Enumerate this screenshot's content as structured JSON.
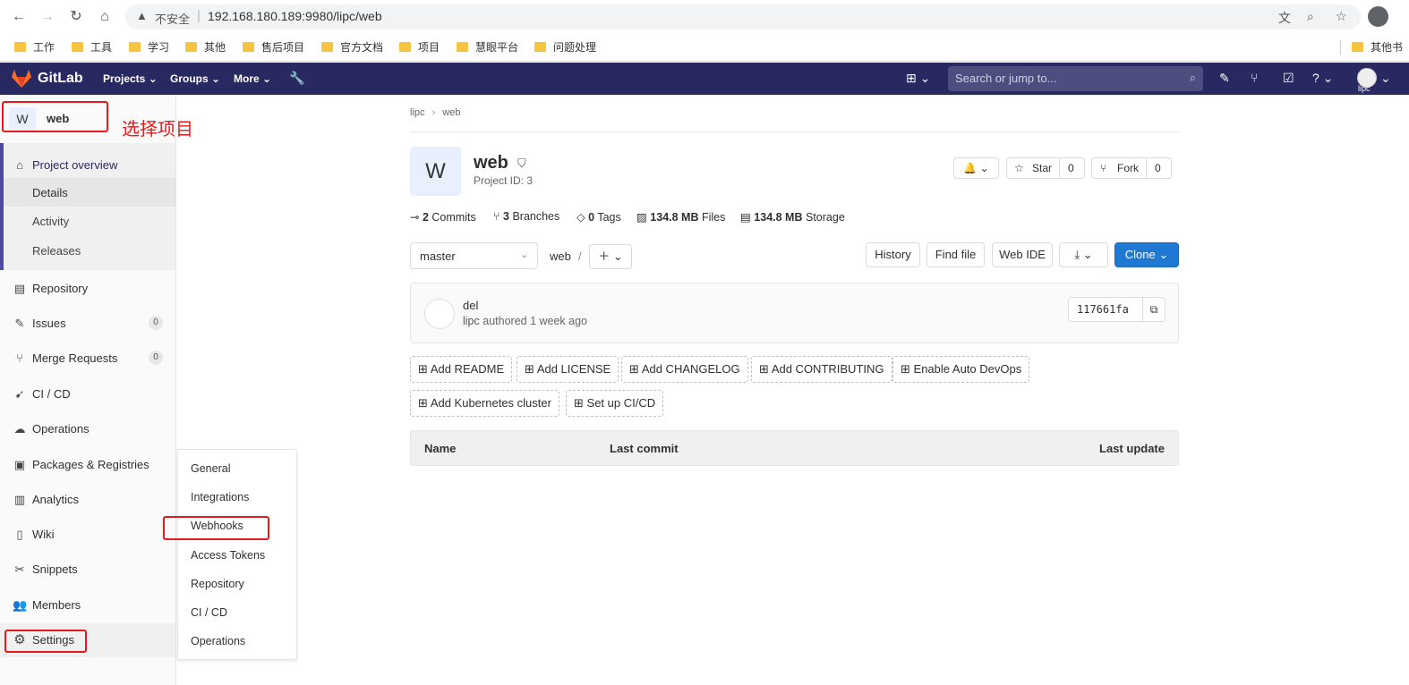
{
  "browser": {
    "insecure_label": "不安全",
    "url": "192.168.180.189:9980/lipc/web",
    "bookmarks": [
      "工作",
      "工具",
      "学习",
      "其他",
      "售后项目",
      "官方文档",
      "项目",
      "慧眼平台",
      "问题处理"
    ],
    "other_bookmarks": "其他书"
  },
  "header": {
    "brand": "GitLab",
    "menu": [
      "Projects",
      "Groups",
      "More"
    ],
    "search_placeholder": "Search or jump to...",
    "avatar_label": "lipc"
  },
  "sidebar": {
    "project_avatar": "W",
    "project_name": "web",
    "annotation": "选择项目",
    "overview": "Project overview",
    "subitems": [
      "Details",
      "Activity",
      "Releases"
    ],
    "items": [
      {
        "label": "Repository"
      },
      {
        "label": "Issues",
        "count": "0"
      },
      {
        "label": "Merge Requests",
        "count": "0"
      },
      {
        "label": "CI / CD"
      },
      {
        "label": "Operations"
      },
      {
        "label": "Packages & Registries"
      },
      {
        "label": "Analytics"
      },
      {
        "label": "Wiki"
      },
      {
        "label": "Snippets"
      },
      {
        "label": "Members"
      },
      {
        "label": "Settings"
      }
    ]
  },
  "flyout": [
    "General",
    "Integrations",
    "Webhooks",
    "Access Tokens",
    "Repository",
    "CI / CD",
    "Operations"
  ],
  "main": {
    "breadcrumb": [
      "lipc",
      "web"
    ],
    "avatar": "W",
    "title": "web",
    "project_id": "Project ID: 3",
    "star_label": "Star",
    "star_count": "0",
    "fork_label": "Fork",
    "fork_count": "0",
    "stats": {
      "commits_num": "2",
      "commits_label": "Commits",
      "branches_num": "3",
      "branches_label": "Branches",
      "tags_num": "0",
      "tags_label": "Tags",
      "files_num": "134.8 MB",
      "files_label": "Files",
      "storage_num": "134.8 MB",
      "storage_label": "Storage"
    },
    "branch": "master",
    "path": "web",
    "path_sep": "/",
    "buttons": {
      "history": "History",
      "find_file": "Find file",
      "web_ide": "Web IDE",
      "clone": "Clone"
    },
    "commit": {
      "title": "del",
      "author": "lipc",
      "meta": "authored 1 week ago",
      "sha": "117661fa"
    },
    "quick_actions": [
      "Add README",
      "Add LICENSE",
      "Add CHANGELOG",
      "Add CONTRIBUTING",
      "Enable Auto DevOps",
      "Add Kubernetes cluster",
      "Set up CI/CD"
    ],
    "table_headers": {
      "name": "Name",
      "last_commit": "Last commit",
      "last_update": "Last update"
    }
  },
  "colors": {
    "header_bg": "#292961",
    "annotation": "#e41b1b",
    "primary": "#1f78d1"
  }
}
